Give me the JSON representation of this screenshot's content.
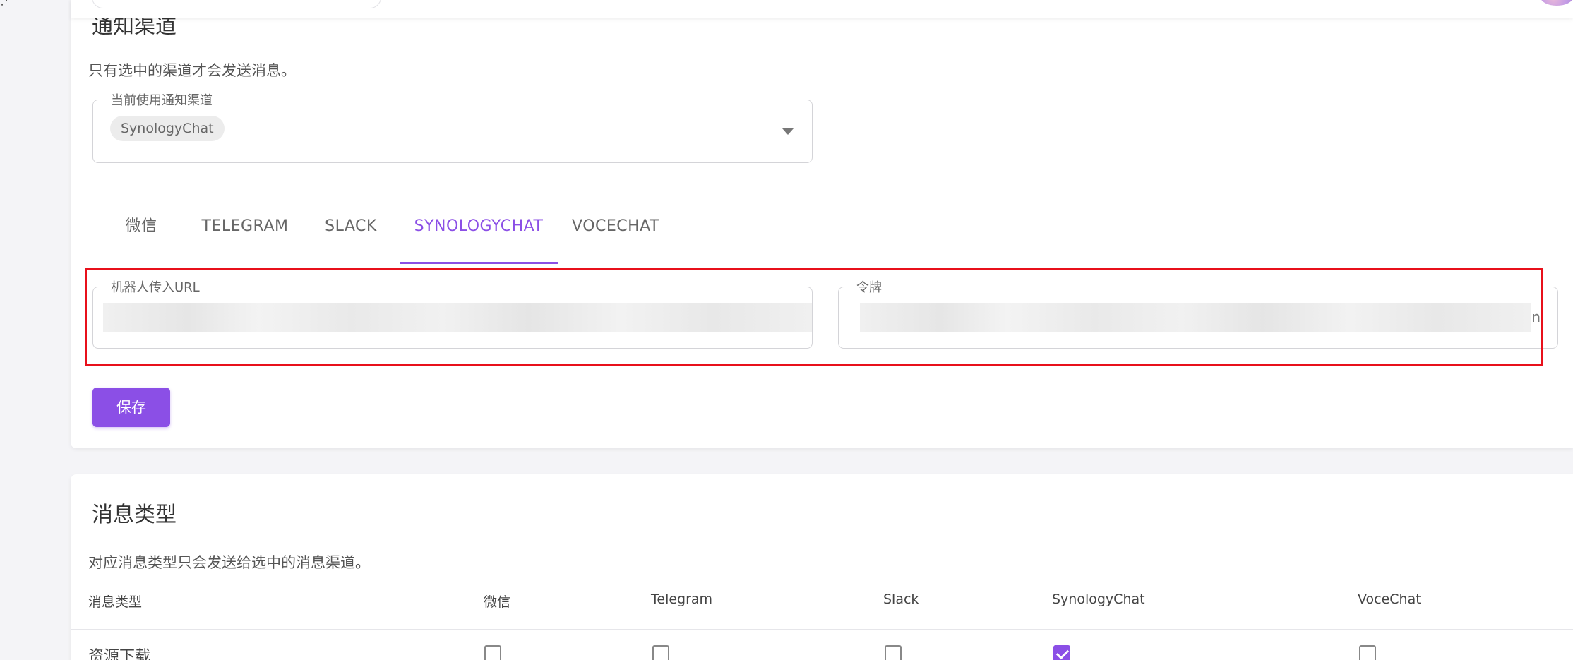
{
  "notify_channels": {
    "title": "通知渠道",
    "subtitle": "只有选中的渠道才会发送消息。",
    "current_field": {
      "legend": "当前使用通知渠道",
      "selected": "SynologyChat"
    },
    "tabs": [
      "微信",
      "TELEGRAM",
      "SLACK",
      "SYNOLOGYCHAT",
      "VOCECHAT"
    ],
    "active_tab": "SYNOLOGYCHAT",
    "url_field": {
      "legend": "机器人传入URL"
    },
    "token_field": {
      "legend": "令牌",
      "visible_tail": "n"
    },
    "save_label": "保存"
  },
  "message_types": {
    "title": "消息类型",
    "subtitle": "对应消息类型只会发送给选中的消息渠道。",
    "columns": [
      "消息类型",
      "微信",
      "Telegram",
      "Slack",
      "SynologyChat",
      "VoceChat"
    ],
    "rows": [
      {
        "label": "资源下载",
        "checked": [
          false,
          false,
          false,
          true,
          false
        ]
      }
    ]
  },
  "colors": {
    "accent": "#8b4fe6",
    "highlight_box": "#e8101b"
  }
}
